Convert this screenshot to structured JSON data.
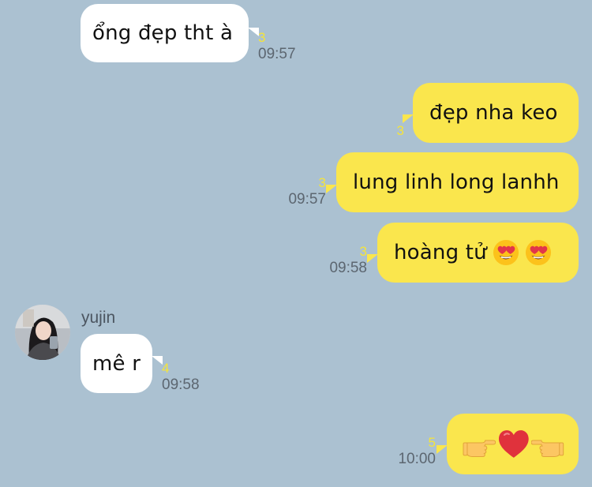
{
  "theme": {
    "background": "#abc1d1",
    "incoming_bubble": "#ffffff",
    "outgoing_bubble": "#fae64d",
    "unread_count_color": "#f5e43a"
  },
  "messages": [
    {
      "id": "m1",
      "direction": "incoming",
      "text": "ổng đẹp tht à",
      "unread": "3",
      "time": "09:57"
    },
    {
      "id": "m2",
      "direction": "outgoing",
      "text": "đẹp nha keo",
      "unread": "3",
      "time": ""
    },
    {
      "id": "m3",
      "direction": "outgoing",
      "text": "lung linh long lanhh",
      "unread": "3",
      "time": "09:57"
    },
    {
      "id": "m4",
      "direction": "outgoing",
      "text": "hoàng tử",
      "emojis": [
        "heart-eyes-emoji",
        "heart-eyes-emoji"
      ],
      "unread": "3",
      "time": "09:58"
    },
    {
      "id": "m5",
      "direction": "incoming",
      "sender": "yujin",
      "avatar": "avatar-photo",
      "text": "mê r",
      "unread": "4",
      "time": "09:58"
    },
    {
      "id": "m6",
      "direction": "outgoing",
      "emojis": [
        "pointing-right-emoji",
        "red-heart-emoji",
        "pointing-left-emoji"
      ],
      "unread": "5",
      "time": "10:00"
    }
  ]
}
